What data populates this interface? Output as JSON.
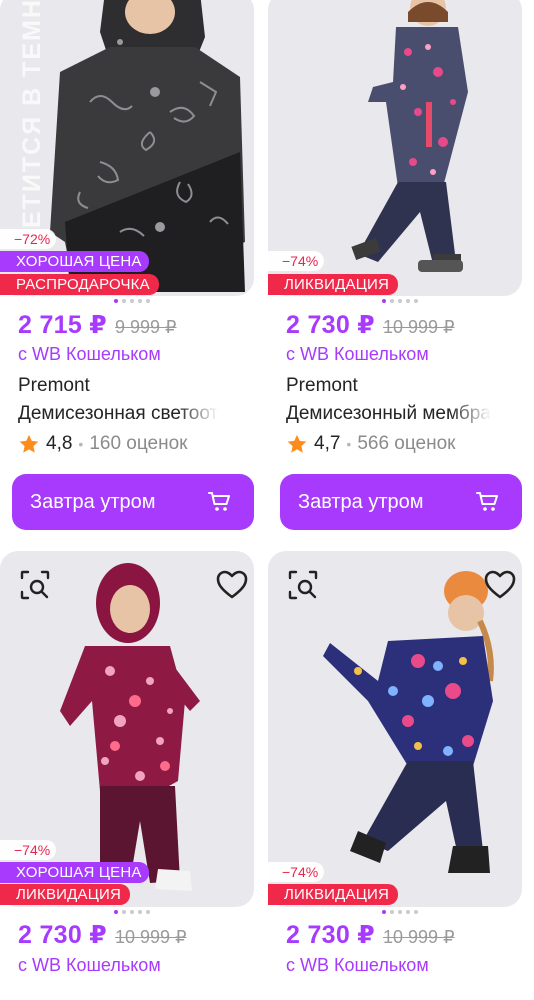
{
  "products": [
    {
      "discount": "−72%",
      "good_price": "ХОРОШАЯ ЦЕНА",
      "tag": "РАСПРОДАРОЧКА",
      "price": "2 715 ₽",
      "old_price": "9 999 ₽",
      "wallet": "с WB Кошельком",
      "brand": "Premont",
      "name": "Демисезонная светоот",
      "rating": "4,8",
      "reviews": "160 оценок",
      "button": "Завтра утром",
      "overlay_text": "ЕТИТСЯ В ТЕМНО"
    },
    {
      "discount": "−74%",
      "tag": "ЛИКВИДАЦИЯ",
      "price": "2 730 ₽",
      "old_price": "10 999 ₽",
      "wallet": "с WB Кошельком",
      "brand": "Premont",
      "name": "Демисезонный мембра",
      "rating": "4,7",
      "reviews": "566 оценок",
      "button": "Завтра утром"
    },
    {
      "discount": "−74%",
      "good_price": "ХОРОШАЯ ЦЕНА",
      "tag": "ЛИКВИДАЦИЯ",
      "price": "2 730 ₽",
      "old_price": "10 999 ₽",
      "wallet": "с WB Кошельком"
    },
    {
      "discount": "−74%",
      "tag": "ЛИКВИДАЦИЯ",
      "price": "2 730 ₽",
      "old_price": "10 999 ₽",
      "wallet": "с WB Кошельком"
    }
  ],
  "icons": {
    "search_similar": "search-similar-icon",
    "favorite": "heart-icon",
    "cart": "cart-icon",
    "star": "star-icon"
  },
  "colors": {
    "accent": "#a73afd",
    "sale": "#f0294b",
    "star": "#ff8c1a"
  }
}
